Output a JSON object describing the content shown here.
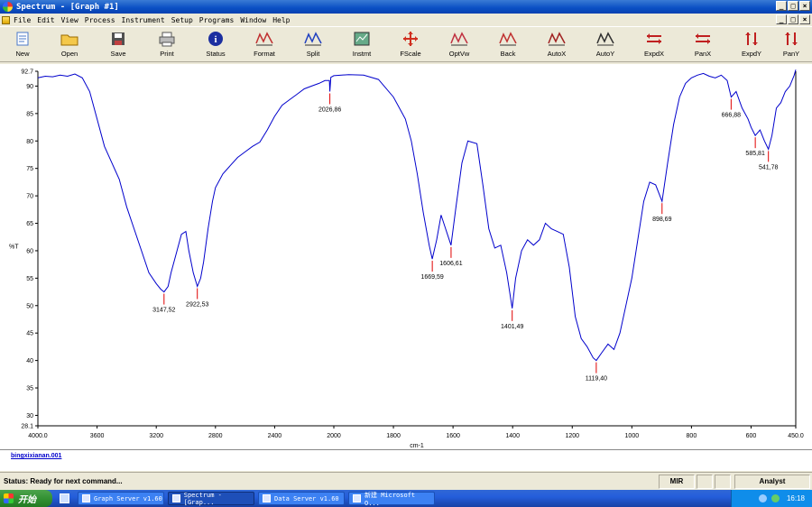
{
  "window": {
    "title": "Spectrum - [Graph #1]"
  },
  "menu": [
    "File",
    "Edit",
    "View",
    "Process",
    "Instrument",
    "Setup",
    "Programs",
    "Window",
    "Help"
  ],
  "toolbar": [
    {
      "label": "New",
      "icon": "new-document-icon"
    },
    {
      "label": "Open",
      "icon": "open-folder-icon"
    },
    {
      "label": "Save",
      "icon": "floppy-disk-icon"
    },
    {
      "label": "Print",
      "icon": "printer-icon"
    },
    {
      "label": "Status",
      "icon": "info-icon"
    },
    {
      "label": "Format",
      "icon": "format-axes-icon"
    },
    {
      "label": "Split",
      "icon": "split-spectrum-icon"
    },
    {
      "label": "Instmt",
      "icon": "instrument-icon"
    },
    {
      "label": "FScale",
      "icon": "four-arrows-icon"
    },
    {
      "label": "OptVw",
      "icon": "options-view-icon"
    },
    {
      "label": "Back",
      "icon": "back-graph-icon"
    },
    {
      "label": "AutoX",
      "icon": "auto-x-icon"
    },
    {
      "label": "AutoY",
      "icon": "auto-y-icon"
    },
    {
      "label": "ExpdX",
      "icon": "expand-x-icon"
    },
    {
      "label": "PanX",
      "icon": "pan-x-icon"
    },
    {
      "label": "ExpdY",
      "icon": "expand-y-icon"
    },
    {
      "label": "PanY",
      "icon": "pan-y-icon"
    }
  ],
  "chart_data": {
    "type": "line",
    "xlabel": "cm-1",
    "ylabel": "%T",
    "xlim": [
      4000.0,
      450.0
    ],
    "ylim": [
      28.1,
      92.7
    ],
    "x_ticks": [
      "4000.0",
      "3600",
      "3200",
      "2800",
      "2400",
      "2000",
      "1800",
      "1600",
      "1400",
      "1200",
      "1000",
      "800",
      "600",
      "450.0"
    ],
    "y_ticks": [
      "92.7",
      "90",
      "85",
      "80",
      "75",
      "70",
      "65",
      "60",
      "55",
      "50",
      "45",
      "40",
      "35",
      "30",
      "28.1"
    ],
    "peaks": [
      {
        "label": "3147,52",
        "x": 3147.52,
        "y": 52.5
      },
      {
        "label": "2922,53",
        "x": 2922.53,
        "y": 53.5
      },
      {
        "label": "2026,86",
        "x": 2026.86,
        "y": 89.0
      },
      {
        "label": "1669,59",
        "x": 1669.59,
        "y": 58.5
      },
      {
        "label": "1606,61",
        "x": 1606.61,
        "y": 61.0
      },
      {
        "label": "1401,49",
        "x": 1401.49,
        "y": 49.5
      },
      {
        "label": "1119,40",
        "x": 1119.4,
        "y": 40.0
      },
      {
        "label": "898,69",
        "x": 898.69,
        "y": 69.0
      },
      {
        "label": "666,88",
        "x": 666.88,
        "y": 88.0
      },
      {
        "label": "585,81",
        "x": 585.81,
        "y": 81.0
      },
      {
        "label": "541,78",
        "x": 541.78,
        "y": 78.5
      }
    ],
    "series": [
      {
        "color": "#0000cc",
        "x": [
          4000,
          3950,
          3900,
          3850,
          3800,
          3750,
          3700,
          3650,
          3600,
          3550,
          3500,
          3450,
          3400,
          3350,
          3300,
          3250,
          3200,
          3170,
          3147.52,
          3120,
          3100,
          3060,
          3030,
          3000,
          2980,
          2950,
          2922.53,
          2900,
          2880,
          2850,
          2820,
          2800,
          2750,
          2700,
          2650,
          2600,
          2550,
          2500,
          2450,
          2400,
          2350,
          2300,
          2250,
          2200,
          2150,
          2100,
          2060,
          2030,
          2026.86,
          2020,
          2000,
          1950,
          1900,
          1850,
          1800,
          1760,
          1740,
          1720,
          1700,
          1680,
          1669.59,
          1655,
          1640,
          1625,
          1606.61,
          1590,
          1570,
          1550,
          1520,
          1500,
          1480,
          1460,
          1440,
          1420,
          1401.49,
          1390,
          1370,
          1350,
          1330,
          1310,
          1290,
          1270,
          1250,
          1230,
          1210,
          1190,
          1170,
          1150,
          1130,
          1119.4,
          1100,
          1080,
          1060,
          1040,
          1020,
          1000,
          980,
          960,
          940,
          920,
          898.69,
          880,
          860,
          840,
          820,
          800,
          780,
          760,
          740,
          720,
          700,
          680,
          666.88,
          650,
          630,
          610,
          600,
          585.81,
          570,
          555,
          541.78,
          530,
          515,
          500,
          485,
          470,
          455,
          450
        ],
        "y": [
          91.5,
          91.8,
          91.7,
          92.0,
          91.8,
          92.2,
          91.5,
          89.0,
          84.0,
          79.0,
          76.0,
          73.0,
          68.0,
          64.0,
          60.0,
          56.0,
          54.0,
          53.0,
          52.5,
          53.5,
          56.0,
          60.0,
          63.0,
          63.5,
          60.0,
          56.0,
          53.5,
          55.0,
          58.0,
          64.0,
          69.0,
          71.5,
          74.0,
          75.5,
          77.0,
          78.0,
          79.0,
          79.8,
          82.0,
          84.5,
          86.5,
          87.5,
          88.5,
          89.5,
          90.0,
          90.5,
          91.0,
          91.0,
          89.0,
          91.6,
          91.9,
          92.1,
          92.0,
          91.2,
          88.0,
          84.0,
          80.0,
          74.0,
          67.0,
          61.0,
          58.5,
          62.0,
          66.5,
          64.0,
          61.0,
          68.0,
          76.0,
          80.0,
          79.5,
          72.0,
          64.0,
          60.5,
          61.0,
          56.0,
          49.5,
          55.0,
          60.0,
          62.0,
          61.0,
          62.0,
          65.0,
          64.0,
          63.5,
          63.0,
          57.0,
          48.0,
          44.0,
          42.5,
          40.5,
          40.0,
          41.5,
          43.0,
          42.0,
          45.0,
          50.0,
          55.0,
          62.0,
          69.0,
          72.5,
          72.0,
          69.0,
          76.0,
          83.0,
          88.0,
          90.5,
          91.5,
          92.0,
          92.3,
          91.8,
          91.5,
          92.0,
          91.0,
          88.0,
          89.0,
          86.0,
          84.0,
          82.5,
          81.0,
          82.0,
          80.0,
          78.5,
          81.0,
          86.0,
          87.0,
          89.0,
          90.0,
          92.0,
          93.0
        ]
      }
    ]
  },
  "file": {
    "name": "bingxixianan.001"
  },
  "status": {
    "text": "Status: Ready for next command...",
    "mode": "MIR",
    "user": "Analyst"
  },
  "taskbar": {
    "start": "开始",
    "items": [
      "Graph Server v1.60",
      "Spectrum - [Grap...",
      "Data Server v1.60",
      "新建 Microsoft O..."
    ],
    "time": "16:18"
  }
}
